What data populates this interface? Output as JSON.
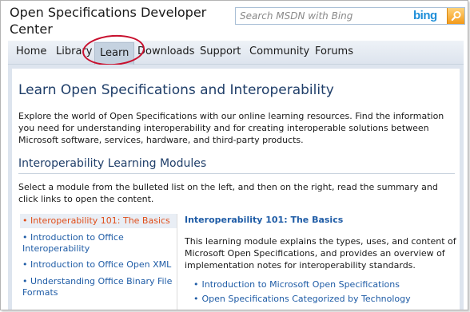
{
  "site": {
    "title": "Open Specifications Developer Center"
  },
  "search": {
    "placeholder": "Search MSDN with Bing",
    "brand": "bing"
  },
  "nav": {
    "items": [
      "Home",
      "Library",
      "Learn",
      "Downloads",
      "Support",
      "Community",
      "Forums"
    ],
    "active": "Learn"
  },
  "page": {
    "title": "Learn Open Specifications and Interoperability",
    "intro": "Explore the world of Open Specifications with our online learning resources. Find the information you need for understanding interoperability and for creating interoperable solutions between Microsoft software, services, hardware, and third-party products."
  },
  "section": {
    "title": "Interoperability Learning Modules",
    "description": "Select a module from the bulleted list on the left, and then on the right, read the summary and click links to open the content."
  },
  "modules": [
    "• Interoperability 101: The Basics",
    "• Introduction to Office Interoperability",
    "• Introduction to Office Open XML",
    "• Understanding Office Binary File Formats"
  ],
  "detail": {
    "title": "Interoperability 101: The Basics",
    "description": "This learning module explains the types, uses, and content of Microsoft Open Specifications, and provides an overview of implementation notes for interoperability standards.",
    "links": [
      "Introduction to Microsoft Open Specifications",
      "Open Specifications Categorized by Technology"
    ]
  },
  "colors": {
    "heading": "#1f3e69",
    "link": "#1f5ca6",
    "selected_module": "#e04e1a",
    "annotation": "#c8102e"
  }
}
